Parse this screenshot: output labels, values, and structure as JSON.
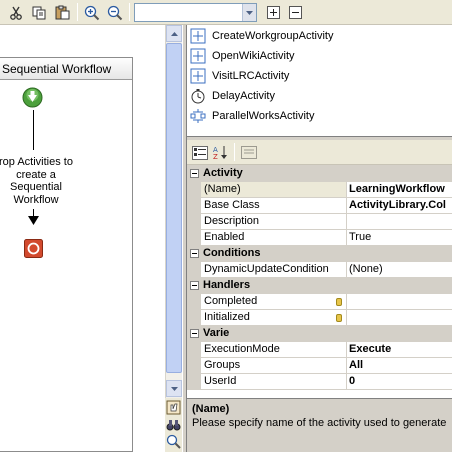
{
  "toolbar": {
    "buttons": [
      "cut-icon",
      "copy-icon",
      "paste-icon",
      "zoom-in-icon",
      "zoom-out-icon"
    ],
    "combo_value": "",
    "expand_icon": "plus-box-icon",
    "collapse_icon": "minus-box-icon"
  },
  "designer": {
    "workflow_title": "Sequential Workflow",
    "drop_text_lines": [
      "rop Activities to",
      "create a",
      "Sequential",
      "Workflow"
    ],
    "start_icon": "green-down-arrow-icon",
    "stop_icon": "red-stop-icon"
  },
  "toolbox": {
    "items": [
      {
        "label": "CreateWorkgroupActivity",
        "icon": "activity-icon"
      },
      {
        "label": "OpenWikiActivity",
        "icon": "activity-icon"
      },
      {
        "label": "VisitLRCActivity",
        "icon": "activity-icon"
      },
      {
        "label": "DelayActivity",
        "icon": "clock-icon"
      },
      {
        "label": "ParallelWorksActivity",
        "icon": "parallel-icon"
      }
    ]
  },
  "properties": {
    "categories": [
      {
        "name": "Activity",
        "rows": [
          {
            "name": "(Name)",
            "value": "LearningWorkflow",
            "bold": true,
            "selected": true
          },
          {
            "name": "Base Class",
            "value": "ActivityLibrary.Col",
            "bold": true
          },
          {
            "name": "Description",
            "value": ""
          },
          {
            "name": "Enabled",
            "value": "True"
          }
        ]
      },
      {
        "name": "Conditions",
        "rows": [
          {
            "name": "DynamicUpdateCondition",
            "value": "(None)"
          }
        ]
      },
      {
        "name": "Handlers",
        "rows": [
          {
            "name": "Completed",
            "value": "",
            "event": true
          },
          {
            "name": "Initialized",
            "value": "",
            "event": true
          }
        ]
      },
      {
        "name": "Varie",
        "rows": [
          {
            "name": "ExecutionMode",
            "value": "Execute",
            "bold": true
          },
          {
            "name": "Groups",
            "value": "All",
            "bold": true
          },
          {
            "name": "UserId",
            "value": "0",
            "bold": true
          }
        ]
      }
    ],
    "description_title": "(Name)",
    "description_text": "Please specify name of the activity used to generate a"
  },
  "colors": {
    "chrome": "#d4d0c8",
    "toolbar": "#ece9d8",
    "scroll_thumb": "#c1d1f4",
    "start_green": "#4ca03c",
    "stop_red": "#d24a2e"
  }
}
